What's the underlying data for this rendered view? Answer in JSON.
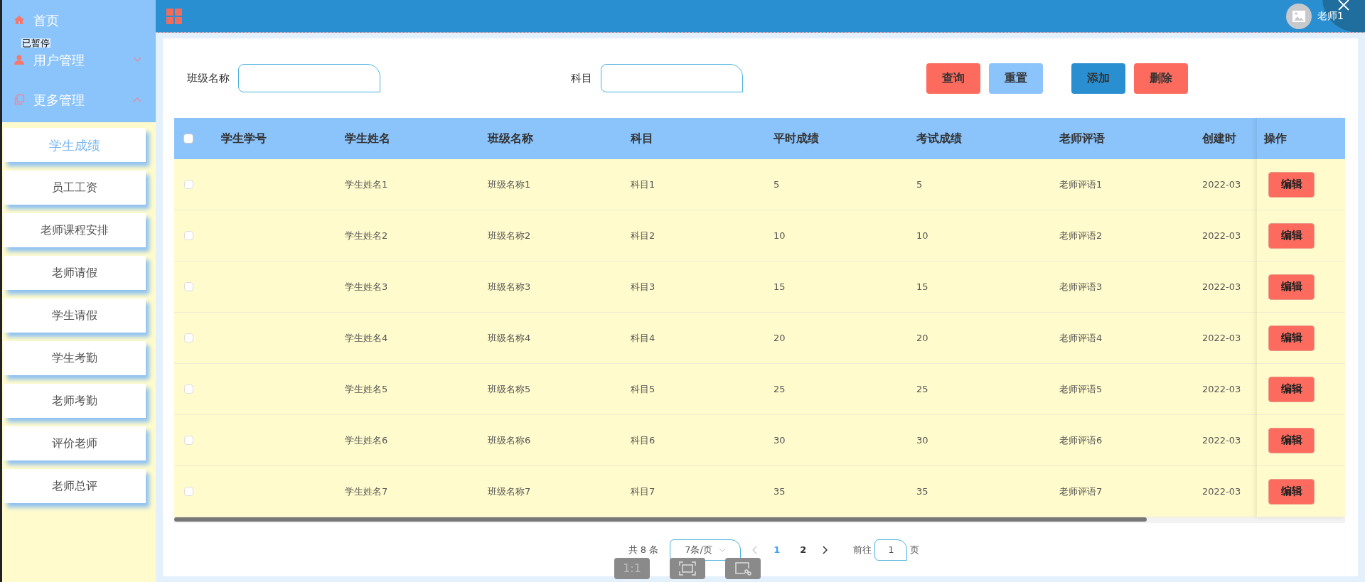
{
  "sidebar": {
    "menus": [
      {
        "label": "首页",
        "kind": "home"
      },
      {
        "label": "用户管理",
        "kind": "user",
        "expanded": false
      },
      {
        "label": "更多管理",
        "kind": "more",
        "expanded": true
      }
    ],
    "items": [
      {
        "label": "学生成绩",
        "selected": true
      },
      {
        "label": "员工工资",
        "selected": false
      },
      {
        "label": "老师课程安排",
        "selected": false
      },
      {
        "label": "老师请假",
        "selected": false
      },
      {
        "label": "学生请假",
        "selected": false
      },
      {
        "label": "学生考勤",
        "selected": false
      },
      {
        "label": "老师考勤",
        "selected": false
      },
      {
        "label": "评价老师",
        "selected": false
      },
      {
        "label": "老师总评",
        "selected": false
      }
    ]
  },
  "overlay_label": "已暂停",
  "header": {
    "user": "老师1"
  },
  "search": {
    "fields": [
      {
        "label": "班级名称"
      },
      {
        "label": "科目"
      }
    ],
    "buttons": [
      {
        "label": "查询",
        "kind": "danger"
      },
      {
        "label": "重置",
        "kind": "light"
      },
      {
        "label": "添加",
        "kind": "primary"
      },
      {
        "label": "删除",
        "kind": "danger"
      }
    ]
  },
  "table": {
    "columns": [
      "学生学号",
      "学生姓名",
      "班级名称",
      "科目",
      "平时成绩",
      "考试成绩",
      "老师评语",
      "创建时"
    ],
    "action_column": "操作",
    "header_checked": false,
    "rows": [
      {
        "checked": false,
        "cells": [
          "",
          "学生姓名1",
          "班级名称1",
          "科目1",
          "5",
          "5",
          "老师评语1",
          "2022-03"
        ],
        "action": "编辑"
      },
      {
        "checked": false,
        "cells": [
          "",
          "学生姓名2",
          "班级名称2",
          "科目2",
          "10",
          "10",
          "老师评语2",
          "2022-03"
        ],
        "action": "编辑"
      },
      {
        "checked": false,
        "cells": [
          "",
          "学生姓名3",
          "班级名称3",
          "科目3",
          "15",
          "15",
          "老师评语3",
          "2022-03"
        ],
        "action": "编辑"
      },
      {
        "checked": false,
        "cells": [
          "",
          "学生姓名4",
          "班级名称4",
          "科目4",
          "20",
          "20",
          "老师评语4",
          "2022-03"
        ],
        "action": "编辑"
      },
      {
        "checked": false,
        "cells": [
          "",
          "学生姓名5",
          "班级名称5",
          "科目5",
          "25",
          "25",
          "老师评语5",
          "2022-03"
        ],
        "action": "编辑"
      },
      {
        "checked": false,
        "cells": [
          "",
          "学生姓名6",
          "班级名称6",
          "科目6",
          "30",
          "30",
          "老师评语6",
          "2022-03"
        ],
        "action": "编辑"
      },
      {
        "checked": false,
        "cells": [
          "",
          "学生姓名7",
          "班级名称7",
          "科目7",
          "35",
          "35",
          "老师评语7",
          "2022-03"
        ],
        "action": "编辑"
      }
    ]
  },
  "pagination": {
    "total": "共 8 条",
    "page_size": "7条/页",
    "pages": [
      {
        "label": "1",
        "selected": true
      },
      {
        "label": "2",
        "selected": false
      }
    ],
    "goto_label": "前往",
    "goto_value": "1",
    "goto_suffix": "页"
  },
  "player_controls": {
    "ratio": "1:1"
  }
}
